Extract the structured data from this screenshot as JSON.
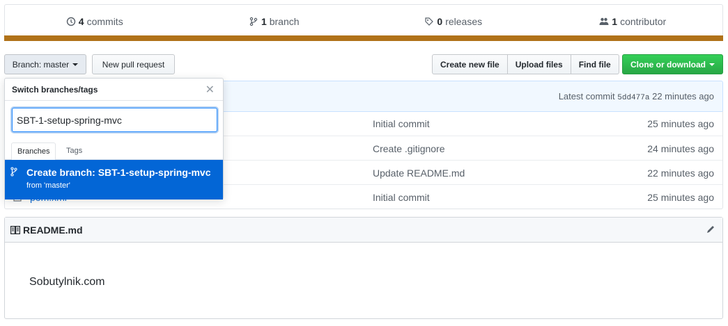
{
  "summary": {
    "commits_num": "4",
    "commits_label": "commits",
    "branches_num": "1",
    "branches_label": "branch",
    "releases_num": "0",
    "releases_label": "releases",
    "contributors_num": "1",
    "contributors_label": "contributor"
  },
  "lang_color": "#b07219",
  "toolbar": {
    "branch_prefix": "Branch:",
    "branch_name": "master",
    "new_pr": "New pull request",
    "create_file": "Create new file",
    "upload_files": "Upload files",
    "find_file": "Find file",
    "clone": "Clone or download"
  },
  "commit_tease": {
    "prefix": "Latest commit",
    "sha": "5dd477a",
    "age": "22 minutes ago"
  },
  "files": [
    {
      "name": "",
      "message": "Initial commit",
      "age": "25 minutes ago"
    },
    {
      "name": "",
      "message": "Create .gitignore",
      "age": "24 minutes ago"
    },
    {
      "name": "",
      "message": "Update README.md",
      "age": "22 minutes ago"
    },
    {
      "name": "pom.xml",
      "message": "Initial commit",
      "age": "25 minutes ago"
    }
  ],
  "readme": {
    "title": "README.md",
    "body": "Sobutylnik.com"
  },
  "dropdown": {
    "title": "Switch branches/tags",
    "input_value": "SBT-1-setup-spring-mvc",
    "tab_branches": "Branches",
    "tab_tags": "Tags",
    "create_label": "Create branch: SBT-1-setup-spring-mvc",
    "create_from": "from 'master'"
  }
}
